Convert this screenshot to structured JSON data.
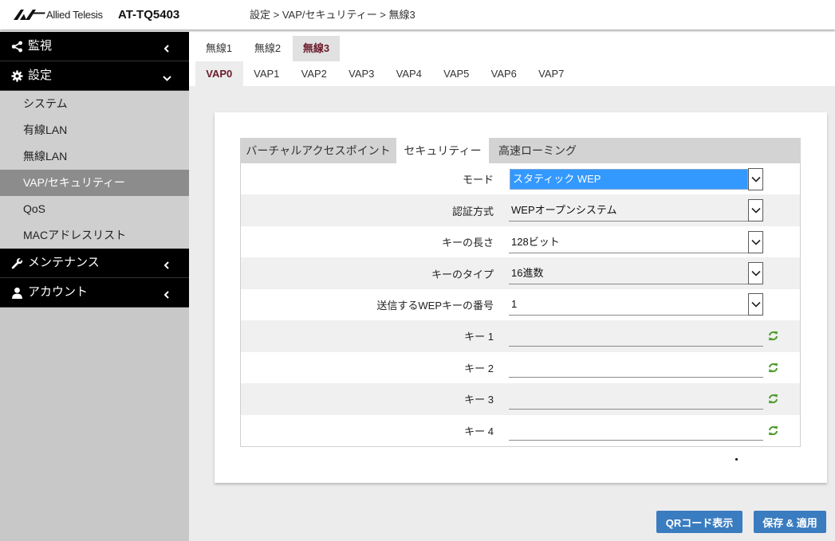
{
  "colors": {
    "accent_button": "#3a7cc0",
    "active_tab_text": "#6a1b2b",
    "select_focus": "#3399ff",
    "refresh_icon": "#4e9a2a",
    "sidebar_group_bg": "#000000",
    "sidebar_active_bg": "#8c8c8c"
  },
  "header": {
    "logo_text": "Allied Telesis",
    "model": "AT-TQ5403",
    "breadcrumb": "設定 > VAP/セキュリティー > 無線3"
  },
  "sidebar": {
    "monitor": {
      "label": "監視",
      "icon": "share-icon",
      "chevron": "chevron-left-icon"
    },
    "settings": {
      "label": "設定",
      "icon": "gear-icon",
      "chevron": "chevron-down-icon",
      "expanded": true,
      "items": [
        {
          "label": "システム",
          "active": false
        },
        {
          "label": "有線LAN",
          "active": false
        },
        {
          "label": "無線LAN",
          "active": false
        },
        {
          "label": "VAP/セキュリティー",
          "active": true
        },
        {
          "label": "QoS",
          "active": false
        },
        {
          "label": "MACアドレスリスト",
          "active": false
        }
      ]
    },
    "maintenance": {
      "label": "メンテナンス",
      "icon": "wrench-icon",
      "chevron": "chevron-left-icon"
    },
    "account": {
      "label": "アカウント",
      "icon": "user-icon",
      "chevron": "chevron-left-icon"
    }
  },
  "radio_tabs": {
    "items": [
      "無線1",
      "無線2",
      "無線3"
    ],
    "active": 2
  },
  "vap_tabs": {
    "items": [
      "VAP0",
      "VAP1",
      "VAP2",
      "VAP3",
      "VAP4",
      "VAP5",
      "VAP6",
      "VAP7"
    ],
    "active": 0
  },
  "panel_tabs": {
    "items": [
      "バーチャルアクセスポイント",
      "セキュリティー",
      "高速ローミング"
    ],
    "active": 1
  },
  "security_form": {
    "mode": {
      "label": "モード",
      "value": "スタティック WEP",
      "focused": true
    },
    "auth_method": {
      "label": "認証方式",
      "value": "WEPオープンシステム"
    },
    "key_length": {
      "label": "キーの長さ",
      "value": "128ビット"
    },
    "key_type": {
      "label": "キーのタイプ",
      "value": "16進数"
    },
    "tx_key_index": {
      "label": "送信するWEPキーの番号",
      "value": "1"
    },
    "keys": [
      {
        "label": "キー 1",
        "value": "",
        "action_icon": "refresh-icon"
      },
      {
        "label": "キー 2",
        "value": "",
        "action_icon": "refresh-icon"
      },
      {
        "label": "キー 3",
        "value": "",
        "action_icon": "refresh-icon"
      },
      {
        "label": "キー 4",
        "value": "",
        "action_icon": "refresh-icon"
      }
    ]
  },
  "buttons": {
    "qr_code": "QRコード表示",
    "save_apply": "保存 & 適用"
  }
}
